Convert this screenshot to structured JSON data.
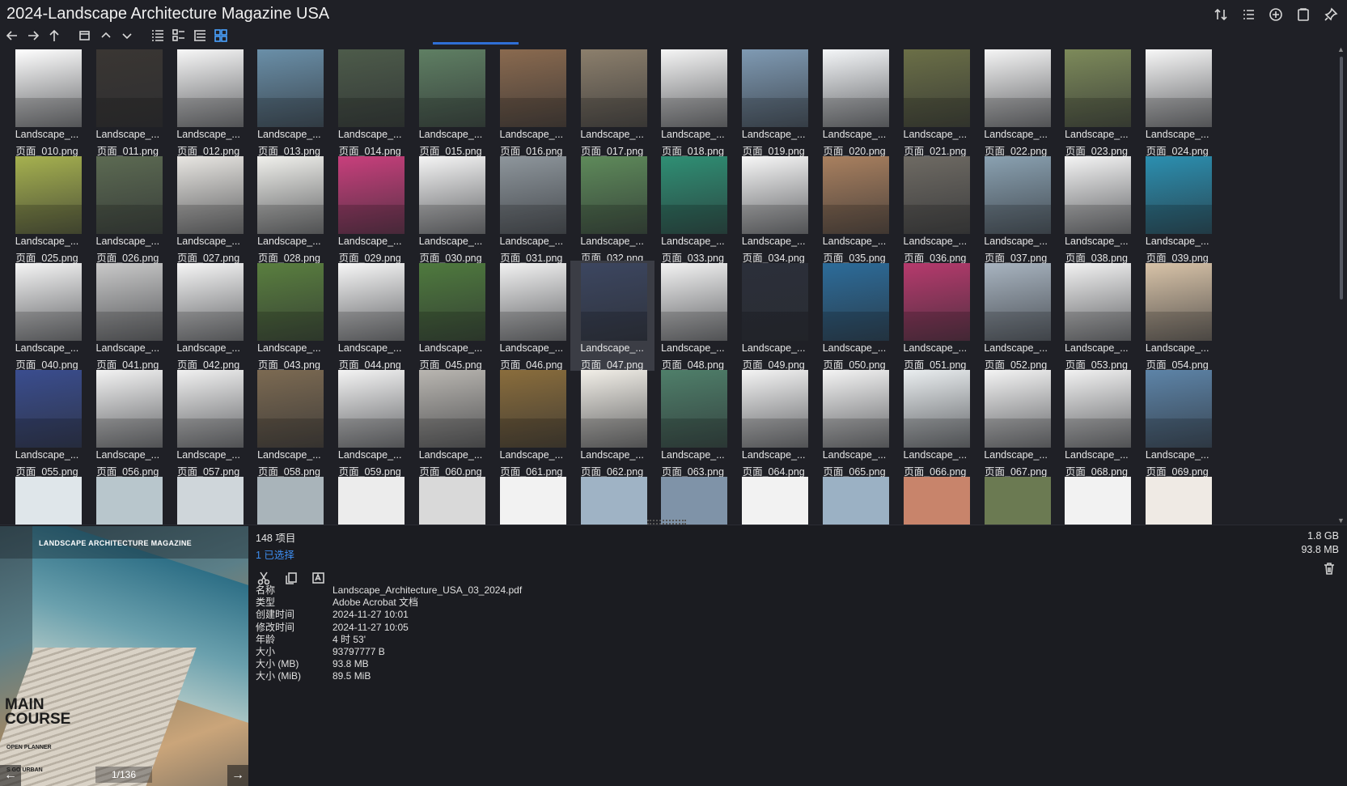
{
  "window": {
    "title": "2024-Landscape Architecture Magazine USA"
  },
  "top_icons": [
    "sort-icon",
    "view-list-icon",
    "add-circle-icon",
    "clipboard-icon",
    "pin-icon"
  ],
  "toolbar_icons": [
    "back-arrow-icon",
    "forward-arrow-icon",
    "up-arrow-icon",
    "window-icon",
    "chevron-up-icon",
    "chevron-down-icon",
    "list-view-icon",
    "details-view-icon",
    "tree-view-icon",
    "grid-view-icon"
  ],
  "files": [
    {
      "name": "Landscape_...",
      "file": "页面_010.png",
      "thumb": "#ffffff"
    },
    {
      "name": "Landscape_...",
      "file": "页面_011.png",
      "thumb": "#3a3633"
    },
    {
      "name": "Landscape_...",
      "file": "页面_012.png",
      "thumb": "#f7f7f7"
    },
    {
      "name": "Landscape_...",
      "file": "页面_013.png",
      "thumb": "#6a8fa8"
    },
    {
      "name": "Landscape_...",
      "file": "页面_014.png",
      "thumb": "#4d5b4a"
    },
    {
      "name": "Landscape_...",
      "file": "页面_015.png",
      "thumb": "#5f7f63"
    },
    {
      "name": "Landscape_...",
      "file": "页面_016.png",
      "thumb": "#8a6a4f"
    },
    {
      "name": "Landscape_...",
      "file": "页面_017.png",
      "thumb": "#8c7f6c"
    },
    {
      "name": "Landscape_...",
      "file": "页面_018.png",
      "thumb": "#f5f5f5"
    },
    {
      "name": "Landscape_...",
      "file": "页面_019.png",
      "thumb": "#7f9ab3"
    },
    {
      "name": "Landscape_...",
      "file": "页面_020.png",
      "thumb": "#f4f6f8"
    },
    {
      "name": "Landscape_...",
      "file": "页面_021.png",
      "thumb": "#6b6f47"
    },
    {
      "name": "Landscape_...",
      "file": "页面_022.png",
      "thumb": "#f5f5f5"
    },
    {
      "name": "Landscape_...",
      "file": "页面_023.png",
      "thumb": "#7d8a5a"
    },
    {
      "name": "Landscape_...",
      "file": "页面_024.png",
      "thumb": "#f7f7f7"
    },
    {
      "name": "Landscape_...",
      "file": "页面_025.png",
      "thumb": "#a6b14f"
    },
    {
      "name": "Landscape_...",
      "file": "页面_026.png",
      "thumb": "#5c6a52"
    },
    {
      "name": "Landscape_...",
      "file": "页面_027.png",
      "thumb": "#e8e6e2"
    },
    {
      "name": "Landscape_...",
      "file": "页面_028.png",
      "thumb": "#f0f0ec"
    },
    {
      "name": "Landscape_...",
      "file": "页面_029.png",
      "thumb": "#c83f7c"
    },
    {
      "name": "Landscape_...",
      "file": "页面_030.png",
      "thumb": "#f5f5f5"
    },
    {
      "name": "Landscape_...",
      "file": "页面_031.png",
      "thumb": "#8e969c"
    },
    {
      "name": "Landscape_...",
      "file": "页面_032.png",
      "thumb": "#5e8a5a"
    },
    {
      "name": "Landscape_...",
      "file": "页面_033.png",
      "thumb": "#2f8f74"
    },
    {
      "name": "Landscape_...",
      "file": "页面_034.png",
      "thumb": "#f7f7f7"
    },
    {
      "name": "Landscape_...",
      "file": "页面_035.png",
      "thumb": "#a9805f"
    },
    {
      "name": "Landscape_...",
      "file": "页面_036.png",
      "thumb": "#6e6a63"
    },
    {
      "name": "Landscape_...",
      "file": "页面_037.png",
      "thumb": "#8aa1b1"
    },
    {
      "name": "Landscape_...",
      "file": "页面_038.png",
      "thumb": "#f4f4f4"
    },
    {
      "name": "Landscape_...",
      "file": "页面_039.png",
      "thumb": "#2b8fb0"
    },
    {
      "name": "Landscape_...",
      "file": "页面_040.png",
      "thumb": "#f5f5f5"
    },
    {
      "name": "Landscape_...",
      "file": "页面_041.png",
      "thumb": "#c9c9c9"
    },
    {
      "name": "Landscape_...",
      "file": "页面_042.png",
      "thumb": "#f6f6f6"
    },
    {
      "name": "Landscape_...",
      "file": "页面_043.png",
      "thumb": "#5a7f3f"
    },
    {
      "name": "Landscape_...",
      "file": "页面_044.png",
      "thumb": "#f7f7f7"
    },
    {
      "name": "Landscape_...",
      "file": "页面_045.png",
      "thumb": "#4f7a3e"
    },
    {
      "name": "Landscape_...",
      "file": "页面_046.png",
      "thumb": "#f2f2f2"
    },
    {
      "name": "Landscape_...",
      "file": "页面_047.png",
      "thumb": "#3c4660"
    },
    {
      "name": "Landscape_...",
      "file": "页面_048.png",
      "thumb": "#f3f3f3"
    },
    {
      "name": "Landscape_...",
      "file": "页面_049.png",
      "thumb": "#2b2f3a"
    },
    {
      "name": "Landscape_...",
      "file": "页面_050.png",
      "thumb": "#2c6c9a"
    },
    {
      "name": "Landscape_...",
      "file": "页面_051.png",
      "thumb": "#b63a6d"
    },
    {
      "name": "Landscape_...",
      "file": "页面_052.png",
      "thumb": "#a8b4c0"
    },
    {
      "name": "Landscape_...",
      "file": "页面_053.png",
      "thumb": "#f2f2f2"
    },
    {
      "name": "Landscape_...",
      "file": "页面_054.png",
      "thumb": "#d8c3a8"
    },
    {
      "name": "Landscape_...",
      "file": "页面_055.png",
      "thumb": "#3a4d8f"
    },
    {
      "name": "Landscape_...",
      "file": "页面_056.png",
      "thumb": "#f3f3f3"
    },
    {
      "name": "Landscape_...",
      "file": "页面_057.png",
      "thumb": "#f1f1f1"
    },
    {
      "name": "Landscape_...",
      "file": "页面_058.png",
      "thumb": "#7c6a52"
    },
    {
      "name": "Landscape_...",
      "file": "页面_059.png",
      "thumb": "#f4f4f4"
    },
    {
      "name": "Landscape_...",
      "file": "页面_060.png",
      "thumb": "#b9b6b1"
    },
    {
      "name": "Landscape_...",
      "file": "页面_061.png",
      "thumb": "#8a6d3c"
    },
    {
      "name": "Landscape_...",
      "file": "页面_062.png",
      "thumb": "#f2efe8"
    },
    {
      "name": "Landscape_...",
      "file": "页面_063.png",
      "thumb": "#4f7f6a"
    },
    {
      "name": "Landscape_...",
      "file": "页面_064.png",
      "thumb": "#f4f4f4"
    },
    {
      "name": "Landscape_...",
      "file": "页面_065.png",
      "thumb": "#f4f4f4"
    },
    {
      "name": "Landscape_...",
      "file": "页面_066.png",
      "thumb": "#eaeef0"
    },
    {
      "name": "Landscape_...",
      "file": "页面_067.png",
      "thumb": "#f4f4f4"
    },
    {
      "name": "Landscape_...",
      "file": "页面_068.png",
      "thumb": "#f2f2f2"
    },
    {
      "name": "Landscape_...",
      "file": "页面_069.png",
      "thumb": "#5d84a8"
    }
  ],
  "partial_row_thumbs": [
    "#dfe6ea",
    "#b8c6cc",
    "#cfd6da",
    "#a9b4ba",
    "#ececec",
    "#d9d9d9",
    "#f2f2f2",
    "#9fb3c5",
    "#7f93a8",
    "#f2f2f2",
    "#9bb1c4",
    "#c8846b",
    "#6b7a52",
    "#f2f2f2",
    "#efeae4"
  ],
  "status": {
    "count": "148 项目",
    "selected": "1 已选择",
    "total_size": "1.8 GB",
    "selected_size": "93.8 MB"
  },
  "action_icons": [
    "cut-icon",
    "copy-icon",
    "rename-icon"
  ],
  "properties": [
    {
      "key": "名称",
      "value": "Landscape_Architecture_USA_03_2024.pdf"
    },
    {
      "key": "类型",
      "value": "Adobe Acrobat 文档"
    },
    {
      "key": "创建时间",
      "value": "2024-11-27  10:01"
    },
    {
      "key": "修改时间",
      "value": "2024-11-27  10:05"
    },
    {
      "key": "年龄",
      "value": "4 时 53'"
    },
    {
      "key": "大小",
      "value": "93797777 B"
    },
    {
      "key": "大小 (MB)",
      "value": "93.8 MB"
    },
    {
      "key": "大小 (MiB)",
      "value": "89.5 MiB"
    }
  ],
  "preview": {
    "magazine_title": "LANDSCAPE ARCHITECTURE MAGAZINE",
    "headline": "MAIN COURSE",
    "sub1": "OPEN PLANNER",
    "sub2": "S GO URBAN",
    "pager": "1/136",
    "prev": "←",
    "next": "→"
  },
  "selected_index": 37,
  "accent": "#3e8ef0"
}
